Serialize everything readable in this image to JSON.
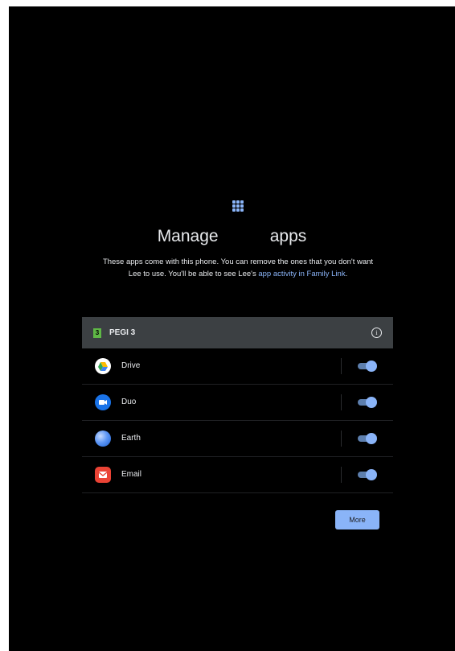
{
  "header": {
    "title": "Manage           apps",
    "description_prefix": "These apps come with this phone. You can remove the ones that you don't want Lee to use. You'll be able to see Lee's ",
    "description_link": "app activity in Family Link",
    "description_suffix": "."
  },
  "rating_section": {
    "badge": "3",
    "label": "PEGI 3",
    "info_icon": "info-icon"
  },
  "apps": [
    {
      "name": "Drive",
      "icon": "drive-icon",
      "enabled": true
    },
    {
      "name": "Duo",
      "icon": "duo-icon",
      "enabled": true
    },
    {
      "name": "Earth",
      "icon": "earth-icon",
      "enabled": true
    },
    {
      "name": "Email",
      "icon": "email-icon",
      "enabled": true
    }
  ],
  "actions": {
    "more_label": "More"
  },
  "colors": {
    "background": "#000000",
    "accent": "#8ab4f8",
    "section_header": "#3c4043",
    "toggle_track": "#5d7fae"
  }
}
